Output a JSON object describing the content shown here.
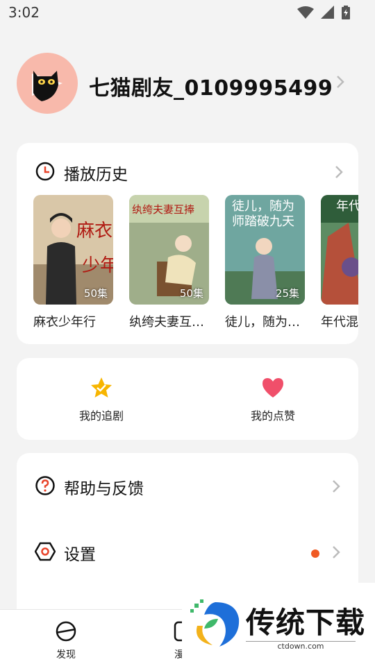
{
  "status_bar": {
    "time": "3:02",
    "icons": [
      "wifi-icon",
      "signal-icon",
      "battery-charging-icon"
    ]
  },
  "profile": {
    "username": "七猫剧友_0109995499",
    "avatar_icon": "cat-play-logo-icon"
  },
  "history": {
    "title": "播放历史",
    "items": [
      {
        "title": "麻衣少年行",
        "episodes": "50集"
      },
      {
        "title": "纨绔夫妻互…",
        "episodes": "50集"
      },
      {
        "title": "徒儿，随为…",
        "episodes": "25集"
      },
      {
        "title": "年代混",
        "episodes": ""
      }
    ]
  },
  "quick_actions": {
    "follow": "我的追剧",
    "likes": "我的点赞"
  },
  "menu": {
    "items": [
      {
        "label": "帮助与反馈",
        "icon": "question-circle-icon"
      },
      {
        "label": "设置",
        "icon": "hexagon-settings-icon",
        "has_dot": true
      }
    ]
  },
  "bottom_nav": {
    "items": [
      {
        "label": "发现",
        "icon": "discover-icon"
      },
      {
        "label": "漫剧",
        "icon": "comic-icon"
      }
    ]
  },
  "watermark": {
    "title": "传统下载",
    "url": "ctdown.com"
  },
  "colors": {
    "accent_orange": "#f05a23",
    "heart_red": "#f04f6a",
    "star_yellow": "#f7b500",
    "avatar_bg": "#f8b9ab"
  }
}
